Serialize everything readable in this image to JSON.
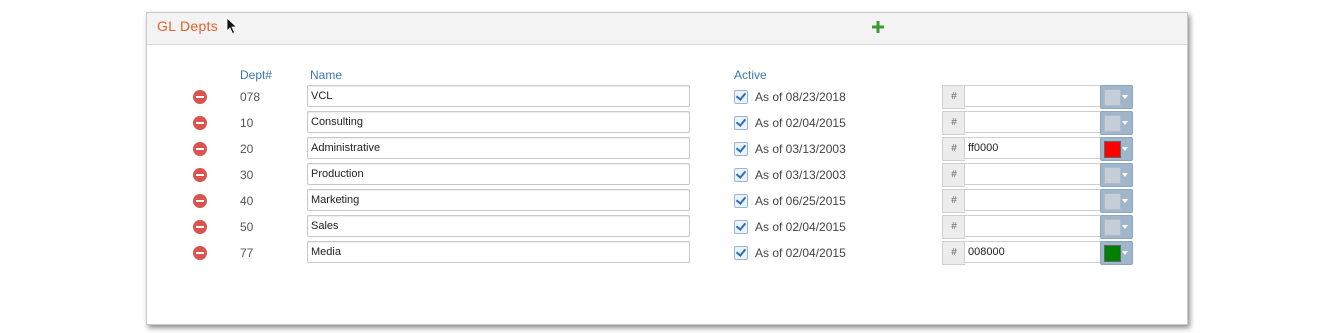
{
  "panel": {
    "title": "GL Depts",
    "add_icon": "plus-icon"
  },
  "columns": {
    "dept": "Dept#",
    "name": "Name",
    "active": "Active"
  },
  "colors": {
    "title": "#e2622c",
    "add": "#3b9a32",
    "remove": "#d9534f",
    "header_text": "#3e77b0",
    "empty_swatch": "#c5ced6"
  },
  "rows": [
    {
      "dept": "078",
      "name": "VCL",
      "active": true,
      "as_of": "As of  08/23/2018",
      "hash": "#",
      "color_value": "",
      "swatch": ""
    },
    {
      "dept": "10",
      "name": "Consulting",
      "active": true,
      "as_of": "As of  02/04/2015",
      "hash": "#",
      "color_value": "",
      "swatch": ""
    },
    {
      "dept": "20",
      "name": "Administrative",
      "active": true,
      "as_of": "As of  03/13/2003",
      "hash": "#",
      "color_value": "ff0000",
      "swatch": "#ff0000"
    },
    {
      "dept": "30",
      "name": "Production",
      "active": true,
      "as_of": "As of  03/13/2003",
      "hash": "#",
      "color_value": "",
      "swatch": ""
    },
    {
      "dept": "40",
      "name": "Marketing",
      "active": true,
      "as_of": "As of  06/25/2015",
      "hash": "#",
      "color_value": "",
      "swatch": ""
    },
    {
      "dept": "50",
      "name": "Sales",
      "active": true,
      "as_of": "As of  02/04/2015",
      "hash": "#",
      "color_value": "",
      "swatch": ""
    },
    {
      "dept": "77",
      "name": "Media",
      "active": true,
      "as_of": "As of  02/04/2015",
      "hash": "#",
      "color_value": "008000",
      "swatch": "#008000"
    }
  ]
}
